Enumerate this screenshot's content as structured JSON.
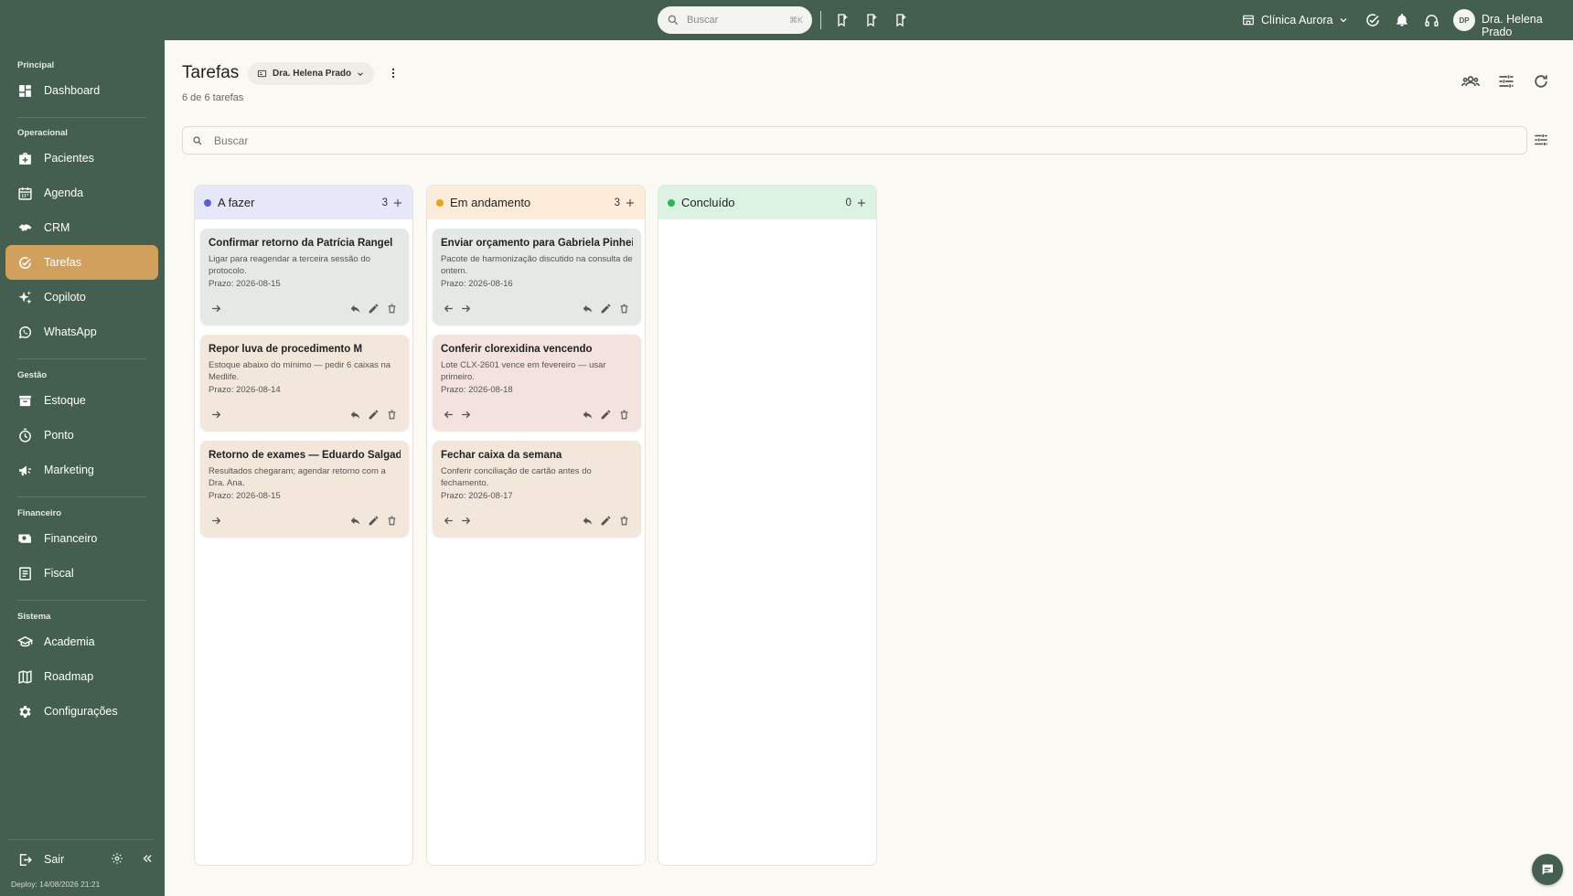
{
  "topbar": {
    "search_placeholder": "Buscar",
    "search_shortcut": "⌘K",
    "clinic": "Clínica Aurora",
    "user_initials": "DP",
    "user_name": "Dra. Helena Prado"
  },
  "sidebar": {
    "sections": {
      "principal": "Principal",
      "operacional": "Operacional",
      "gestao": "Gestão",
      "financeiro": "Financeiro",
      "sistema": "Sistema"
    },
    "items": {
      "dashboard": "Dashboard",
      "pacientes": "Pacientes",
      "agenda": "Agenda",
      "crm": "CRM",
      "tarefas": "Tarefas",
      "copiloto": "Copiloto",
      "whatsapp": "WhatsApp",
      "estoque": "Estoque",
      "ponto": "Ponto",
      "marketing": "Marketing",
      "financeiro": "Financeiro",
      "fiscal": "Fiscal",
      "academia": "Academia",
      "roadmap": "Roadmap",
      "configuracoes": "Configurações"
    },
    "active": "tarefas",
    "logout": "Sair",
    "deploy": "Deploy: 14/08/2026 21:21"
  },
  "page": {
    "title": "Tarefas",
    "owner_filter": "Dra. Helena Prado",
    "subtitle": "6 de 6 tarefas",
    "search_placeholder": "Buscar"
  },
  "board": {
    "columns": [
      {
        "name": "A fazer",
        "count": "3",
        "dot_color": "#5b5fd6",
        "head_bg": "#e6e7f8",
        "cards": [
          {
            "title": "Confirmar retorno da Patrícia Rangel",
            "desc": "Ligar para reagendar a terceira sessão do protocolo.",
            "due": "Prazo: 2026-08-15",
            "bg": "#e4e9e5"
          },
          {
            "title": "Repor luva de procedimento M",
            "desc": "Estoque abaixo do mínimo — pedir 6 caixas na Medlife.",
            "due": "Prazo: 2026-08-14",
            "bg": "#f3e7dc"
          },
          {
            "title": "Retorno de exames — Eduardo Salgado",
            "desc": "Resultados chegaram; agendar retorno com a Dra. Ana.",
            "due": "Prazo: 2026-08-15",
            "bg": "#f3e7dc"
          }
        ]
      },
      {
        "name": "Em andamento",
        "count": "3",
        "dot_color": "#e8a21b",
        "head_bg": "#fdecd9",
        "cards": [
          {
            "title": "Enviar orçamento para Gabriela Pinheiro",
            "desc": "Pacote de harmonização discutido na consulta de ontem.",
            "due": "Prazo: 2026-08-16",
            "bg": "#e4e9e5"
          },
          {
            "title": "Conferir clorexidina vencendo",
            "desc": "Lote CLX-2601 vence em fevereiro — usar primeiro.",
            "due": "Prazo: 2026-08-18",
            "bg": "#f3e2de"
          },
          {
            "title": "Fechar caixa da semana",
            "desc": "Conferir conciliação de cartão antes do fechamento.",
            "due": "Prazo: 2026-08-17",
            "bg": "#f3e7dc"
          }
        ]
      },
      {
        "name": "Concluído",
        "count": "0",
        "dot_color": "#2fb45a",
        "head_bg": "#dcf3e3",
        "cards": []
      }
    ]
  }
}
